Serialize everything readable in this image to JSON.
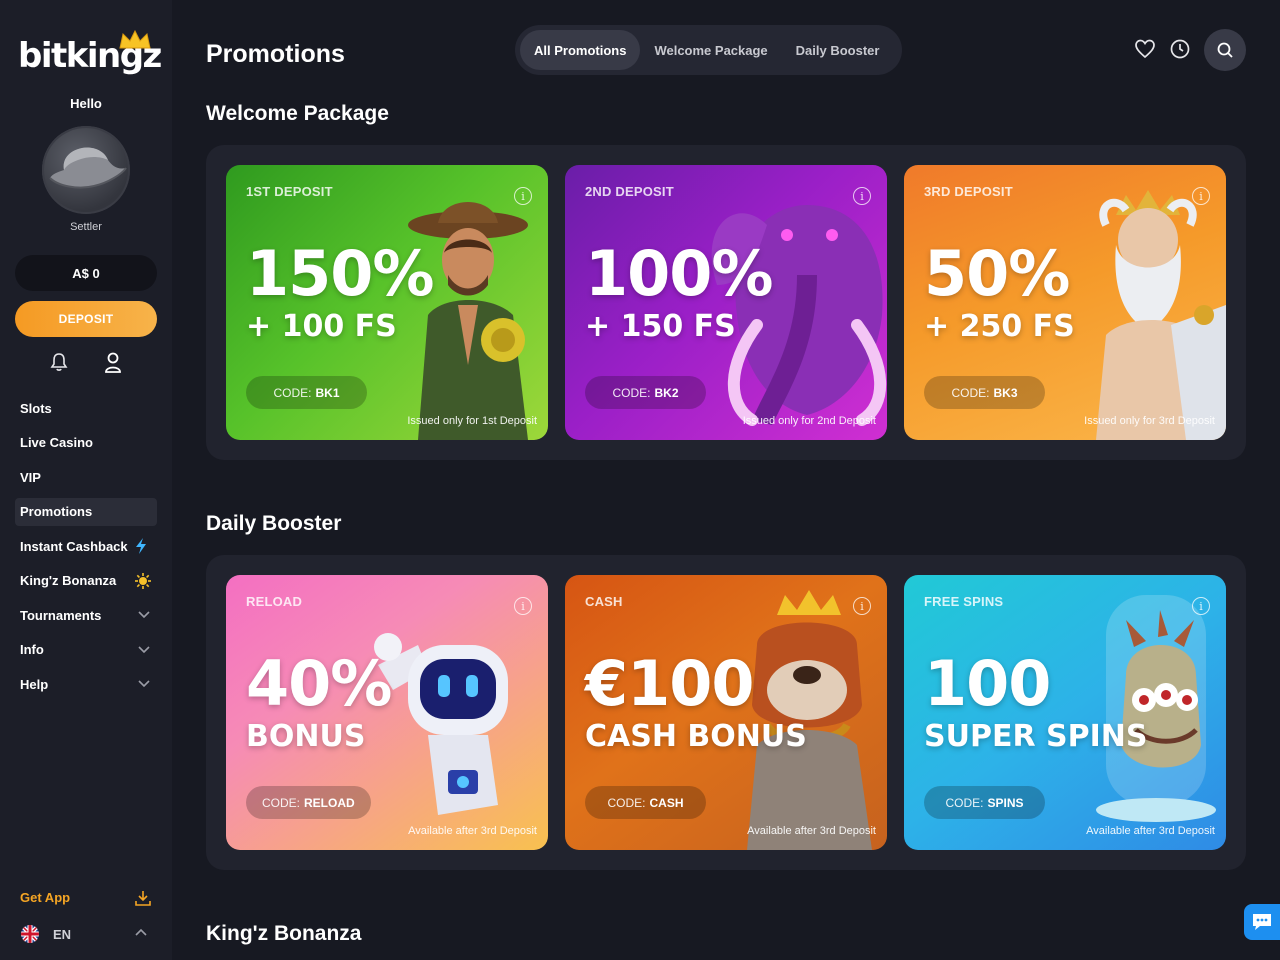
{
  "brand": {
    "logo_text": "bitkingz",
    "accent": "#f5a524"
  },
  "sidebar": {
    "greeting": "Hello",
    "rank": "Settler",
    "balance": "A$ 0",
    "deposit_label": "DEPOSIT",
    "nav": [
      {
        "label": "Slots"
      },
      {
        "label": "Live Casino"
      },
      {
        "label": "VIP"
      },
      {
        "label": "Promotions",
        "active": true
      },
      {
        "label": "Instant Cashback",
        "icon": "lightning-icon"
      },
      {
        "label": "King'z Bonanza",
        "icon": "sun-icon"
      },
      {
        "label": "Tournaments",
        "icon": "chevron-down-icon"
      },
      {
        "label": "Info",
        "icon": "chevron-down-icon"
      },
      {
        "label": "Help",
        "icon": "chevron-down-icon"
      }
    ],
    "get_app": "Get App",
    "language": "EN"
  },
  "header": {
    "title": "Promotions",
    "tabs": [
      {
        "label": "All Promotions",
        "active": true
      },
      {
        "label": "Welcome Package"
      },
      {
        "label": "Daily Booster"
      }
    ]
  },
  "welcome": {
    "title": "Welcome Package",
    "cards": [
      {
        "tag": "1ST DEPOSIT",
        "big": "150%",
        "sub": "+ 100 FS",
        "code_label": "CODE:",
        "code": "BK1",
        "note": "Issued only for 1st Deposit"
      },
      {
        "tag": "2ND DEPOSIT",
        "big": "100%",
        "sub": "+ 150 FS",
        "code_label": "CODE:",
        "code": "BK2",
        "note": "Issued only for 2nd Deposit"
      },
      {
        "tag": "3RD DEPOSIT",
        "big": "50%",
        "sub": "+ 250 FS",
        "code_label": "CODE:",
        "code": "BK3",
        "note": "Issued only for 3rd Deposit"
      }
    ]
  },
  "daily": {
    "title": "Daily Booster",
    "cards": [
      {
        "tag": "RELOAD",
        "big": "40%",
        "sub": "BONUS",
        "code_label": "CODE:",
        "code": "RELOAD",
        "note": "Available after 3rd Deposit"
      },
      {
        "tag": "CASH",
        "big": "€100",
        "sub": "CASH BONUS",
        "code_label": "CODE:",
        "code": "CASH",
        "note": "Available after 3rd Deposit"
      },
      {
        "tag": "FREE SPINS",
        "big": "100",
        "sub": "SUPER SPINS",
        "code_label": "CODE:",
        "code": "SPINS",
        "note": "Available after 3rd Deposit"
      }
    ]
  },
  "bonanza": {
    "title": "King'z Bonanza"
  },
  "info_glyph": "i"
}
